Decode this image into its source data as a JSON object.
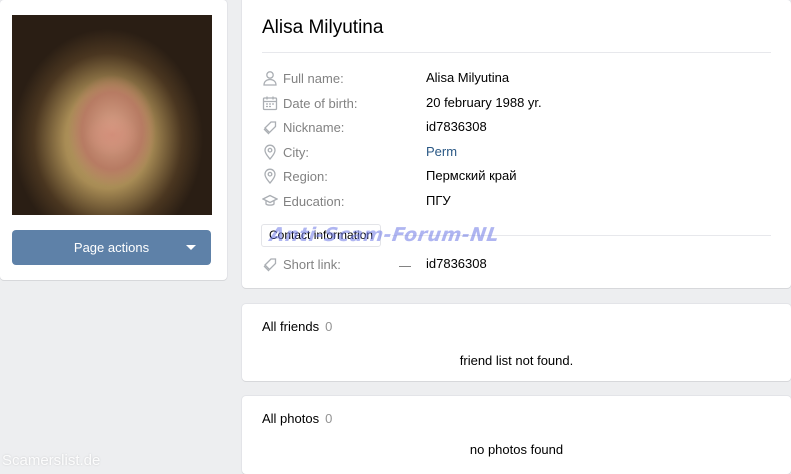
{
  "left": {
    "page_actions_label": "Page actions"
  },
  "profile": {
    "name": "Alisa Milyutina",
    "rows": [
      {
        "icon": "user-icon",
        "label": "Full name:",
        "value": "Alisa Milyutina"
      },
      {
        "icon": "calendar-icon",
        "label": "Date of birth:",
        "value": "20 february 1988 yr."
      },
      {
        "icon": "tag-icon",
        "label": "Nickname:",
        "value": "id7836308"
      },
      {
        "icon": "location-pin-icon",
        "label": "City:",
        "value": "Perm"
      },
      {
        "icon": "location-pin-icon",
        "label": "Region:",
        "value": "Пермский край"
      },
      {
        "icon": "graduation-cap-icon",
        "label": "Education:",
        "value": "ПГУ"
      }
    ],
    "contact_button_label": "Contact information",
    "short_link": {
      "icon": "tag-icon",
      "label": "Short link:",
      "value": "id7836308"
    }
  },
  "friends": {
    "title": "All friends",
    "count": "0",
    "empty_text": "friend list not found."
  },
  "photos": {
    "title": "All photos",
    "count": "0",
    "empty_text": "no photos found"
  },
  "watermarks": {
    "center": "Anti-Scam-Forum-NL",
    "corner": "Scamerslist.de"
  },
  "colors": {
    "background": "#edeef0",
    "button": "#5e81a8",
    "link": "#2a5885",
    "label_gray": "#828282"
  }
}
